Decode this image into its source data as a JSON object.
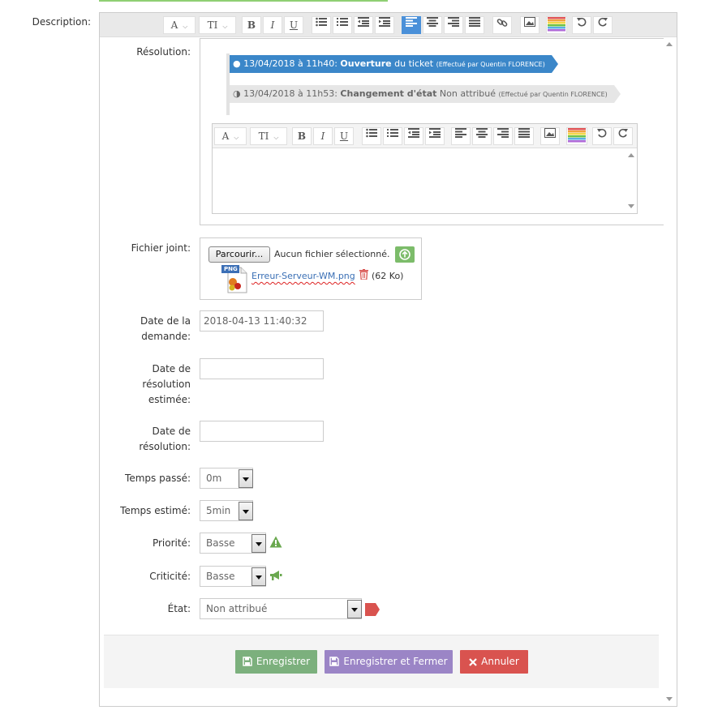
{
  "description_label": "Description:",
  "toolbar": {
    "font_button": "A",
    "size_button": "TI",
    "bold": "B",
    "italic": "I",
    "underline": "U"
  },
  "resolution": {
    "label": "Résolution:",
    "timeline": [
      {
        "date": "13/04/2018 à 11h40:",
        "action": "Ouverture",
        "detail": "du ticket",
        "by": "(Effectué par Quentin FLORENCE)"
      },
      {
        "date": "13/04/2018 à 11h53:",
        "action": "Changement d'état",
        "detail": "Non attribué",
        "by": "(Effectué par Quentin FLORENCE)"
      }
    ]
  },
  "attachment": {
    "label": "Fichier joint:",
    "browse_label": "Parcourir...",
    "no_file_text": "Aucun fichier sélectionné.",
    "file_type": "PNG",
    "file_name": "Erreur-Serveur-WM.png",
    "file_size": "(62 Ko)"
  },
  "fields": {
    "request_date_label": "Date de la demande:",
    "request_date_value": "2018-04-13 11:40:32",
    "estimated_resolution_label": "Date de résolution estimée:",
    "estimated_resolution_value": "",
    "resolution_date_label": "Date de résolution:",
    "resolution_date_value": "",
    "time_spent_label": "Temps passé:",
    "time_spent_value": "0m",
    "time_estimated_label": "Temps estimé:",
    "time_estimated_value": "5min",
    "priority_label": "Priorité:",
    "priority_value": "Basse",
    "criticality_label": "Criticité:",
    "criticality_value": "Basse",
    "state_label": "État:",
    "state_value": "Non attribué"
  },
  "actions": {
    "save": "Enregistrer",
    "save_close": "Enregistrer et Fermer",
    "cancel": "Annuler"
  },
  "colors": {
    "active_tool": "#4a90d9",
    "timeline_current": "#3b87c9",
    "save_button": "#7cb07d",
    "save_close_button": "#9b85c6",
    "cancel_button": "#d9534f",
    "priority_icon": "#6aa84f",
    "state_flag": "#d9534f"
  }
}
